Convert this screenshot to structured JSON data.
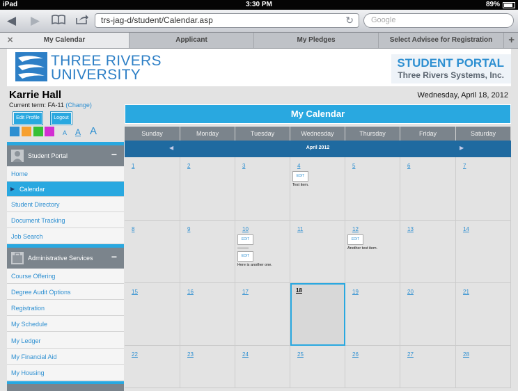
{
  "status": {
    "carrier": "iPad",
    "time": "3:30 PM",
    "battery": "89%"
  },
  "browser": {
    "url": "trs-jag-d/student/Calendar.asp",
    "search_placeholder": "Google",
    "tabs": [
      {
        "label": "My Calendar",
        "active": true
      },
      {
        "label": "Applicant",
        "active": false
      },
      {
        "label": "My Pledges",
        "active": false
      },
      {
        "label": "Select Advisee for Registration",
        "active": false
      }
    ]
  },
  "header": {
    "logo_line1": "THREE RIVERS",
    "logo_line2": "UNIVERSITY",
    "portal_title": "STUDENT PORTAL",
    "portal_sub": "Three Rivers Systems, Inc."
  },
  "user": {
    "name": "Karrie Hall",
    "term_label": "Current term: FA-11",
    "change_label": "(Change)",
    "date": "Wednesday, April 18, 2012",
    "edit_profile": "Edit Profile",
    "logout": "Logout",
    "font_sizes": [
      "A",
      "A",
      "A"
    ],
    "swatch_colors": [
      "#2d8fd1",
      "#f6a030",
      "#36c036",
      "#d22fd2"
    ]
  },
  "sidebar": {
    "sections": [
      {
        "title": "Student Portal",
        "toggle": "−",
        "items": [
          "Home",
          "Calendar",
          "Student Directory",
          "Document Tracking",
          "Job Search"
        ]
      },
      {
        "title": "Administrative Services",
        "toggle": "−",
        "items": [
          "Course Offering",
          "Degree Audit Options",
          "Registration",
          "My Schedule",
          "My Ledger",
          "My Financial Aid",
          "My Housing"
        ]
      }
    ],
    "selected": "Calendar"
  },
  "calendar": {
    "title": "My Calendar",
    "month": "April 2012",
    "prev": "◀",
    "next": "▶",
    "day_names": [
      "Sunday",
      "Monday",
      "Tuesday",
      "Wednesday",
      "Thursday",
      "Friday",
      "Saturday"
    ],
    "weeks": [
      [
        "1",
        "2",
        "3",
        "4",
        "5",
        "6",
        "7"
      ],
      [
        "8",
        "9",
        "10",
        "11",
        "12",
        "13",
        "14"
      ],
      [
        "15",
        "16",
        "17",
        "18",
        "19",
        "20",
        "21"
      ],
      [
        "22",
        "23",
        "24",
        "25",
        "26",
        "27",
        "28"
      ]
    ],
    "today": "18",
    "edit_label": "EDIT",
    "events": [
      {
        "day": "4",
        "text": "Test item."
      },
      {
        "day": "10",
        "text": ""
      },
      {
        "day": "10",
        "text": "Here is another one."
      },
      {
        "day": "12",
        "text": "Another test item."
      }
    ]
  },
  "accent": "#29a8e0"
}
